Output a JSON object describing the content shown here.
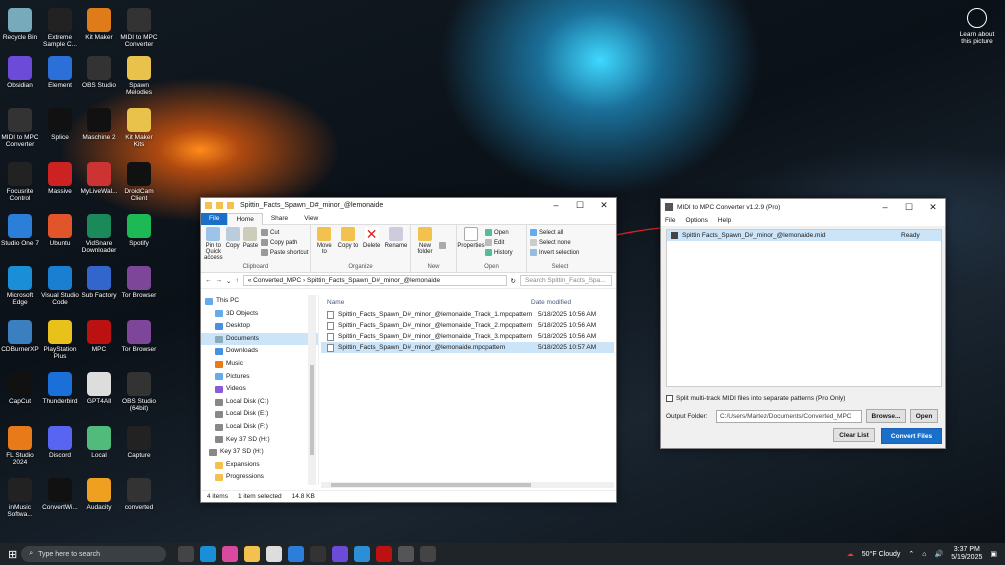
{
  "desktop": {
    "icons": [
      {
        "label": "Recycle Bin",
        "color": "#7ab"
      },
      {
        "label": "Extreme Sample C...",
        "color": "#222"
      },
      {
        "label": "Kit Maker",
        "color": "#e07b1a"
      },
      {
        "label": "MIDI to MPC Converter",
        "color": "#333"
      },
      {
        "label": "Obsidian",
        "color": "#6b4bd8"
      },
      {
        "label": "Element",
        "color": "#2b6fd8"
      },
      {
        "label": "OBS Studio",
        "color": "#333"
      },
      {
        "label": "Spawn Melodies",
        "color": "#e8c24a"
      },
      {
        "label": "MIDI to MPC Converter",
        "color": "#333"
      },
      {
        "label": "Splice",
        "color": "#111"
      },
      {
        "label": "Maschine 2",
        "color": "#111"
      },
      {
        "label": "Kit Maker Kits",
        "color": "#e8c24a"
      },
      {
        "label": "Focusrite Control",
        "color": "#222"
      },
      {
        "label": "Massive",
        "color": "#c22"
      },
      {
        "label": "MyLiveWal...",
        "color": "#c33"
      },
      {
        "label": "DroidCam Client",
        "color": "#111"
      },
      {
        "label": "Studio One 7",
        "color": "#2b7fd8"
      },
      {
        "label": "Ubuntu",
        "color": "#e2542a"
      },
      {
        "label": "VidSnare Downloader",
        "color": "#1b8a5a"
      },
      {
        "label": "Spotify",
        "color": "#1db954"
      },
      {
        "label": "Microsoft Edge",
        "color": "#1a8fd8"
      },
      {
        "label": "Visual Studio Code",
        "color": "#1a7fd0"
      },
      {
        "label": "Sub Factory",
        "color": "#3366cc"
      },
      {
        "label": "Tor Browser",
        "color": "#7d4698"
      },
      {
        "label": "CDBurnerXP",
        "color": "#3a7fc0"
      },
      {
        "label": "PlayStation Plus",
        "color": "#e8c21a"
      },
      {
        "label": "MPC",
        "color": "#b11"
      },
      {
        "label": "Tor Browser",
        "color": "#7d4698"
      },
      {
        "label": "CapCut",
        "color": "#111"
      },
      {
        "label": "Thunderbird",
        "color": "#1a6fd8"
      },
      {
        "label": "GPT4All",
        "color": "#ddd"
      },
      {
        "label": "OBS Studio (64bit)",
        "color": "#333"
      },
      {
        "label": "FL Studio 2024",
        "color": "#e87a1a"
      },
      {
        "label": "Discord",
        "color": "#5865f2"
      },
      {
        "label": "Local",
        "color": "#51bb7b"
      },
      {
        "label": "Capture",
        "color": "#222"
      },
      {
        "label": "inMusic Softwa...",
        "color": "#222"
      },
      {
        "label": "ConvertWi...",
        "color": "#111"
      },
      {
        "label": "Audacity",
        "color": "#f0a020"
      },
      {
        "label": "converted",
        "color": "#333"
      }
    ],
    "learn": "Learn about this picture"
  },
  "explorer": {
    "title": "Spittin_Facts_Spawn_D#_minor_@lemonaide",
    "tabs": [
      "File",
      "Home",
      "Share",
      "View"
    ],
    "ribbon": {
      "clipboard": {
        "label": "Clipboard",
        "pin": "Pin to Quick access",
        "copy": "Copy",
        "paste": "Paste",
        "cut": "Cut",
        "copy_path": "Copy path",
        "paste_shortcut": "Paste shortcut"
      },
      "organize": {
        "label": "Organize",
        "move": "Move to",
        "copy": "Copy to",
        "delete": "Delete",
        "rename": "Rename"
      },
      "new": {
        "label": "New",
        "folder": "New folder"
      },
      "open": {
        "label": "Open",
        "properties": "Properties",
        "open": "Open",
        "edit": "Edit",
        "history": "History"
      },
      "select": {
        "label": "Select",
        "all": "Select all",
        "none": "Select none",
        "invert": "Invert selection"
      }
    },
    "address": {
      "prefix": "«",
      "part1": "Converted_MPC",
      "sep": "›",
      "part2": "Spittin_Facts_Spawn_D#_minor_@lemonaide",
      "search": "Search Spittin_Facts_Spa..."
    },
    "nav": [
      "This PC",
      "3D Objects",
      "Desktop",
      "Documents",
      "Downloads",
      "Music",
      "Pictures",
      "Videos",
      "Local Disk (C:)",
      "Local Disk (E:)",
      "Local Disk (F:)",
      "Key 37 SD (H:)",
      "Key 37 SD (H:)",
      "Expansions",
      "Progressions"
    ],
    "columns": {
      "name": "Name",
      "date": "Date modified"
    },
    "files": [
      {
        "name": "Spittin_Facts_Spawn_D#_minor_@lemonaide_Track_1.mpcpattern",
        "date": "5/18/2025 10:56 AM"
      },
      {
        "name": "Spittin_Facts_Spawn_D#_minor_@lemonaide_Track_2.mpcpattern",
        "date": "5/18/2025 10:56 AM"
      },
      {
        "name": "Spittin_Facts_Spawn_D#_minor_@lemonaide_Track_3.mpcpattern",
        "date": "5/18/2025 10:56 AM"
      },
      {
        "name": "Spittin_Facts_Spawn_D#_minor_@lemonaide.mpcpattern",
        "date": "5/18/2025 10:57 AM"
      }
    ],
    "status": {
      "items": "4 items",
      "selected": "1 item selected",
      "size": "14.8 KB"
    }
  },
  "converter": {
    "title": "MIDI to MPC Converter v1.2.9 (Pro)",
    "menu": [
      "File",
      "Options",
      "Help"
    ],
    "file": {
      "name": "Spittin Facts_Spawn_D#_minor_@lemonaide.mid",
      "status": "Ready"
    },
    "split_label": "Split multi-track MIDI files into separate patterns (Pro Only)",
    "output_label": "Output Folder:",
    "output_path": "C:/Users/Martez/Documents/Converted_MPC",
    "browse": "Browse...",
    "open": "Open",
    "clear": "Clear List",
    "convert": "Convert Files"
  },
  "taskbar": {
    "search": "Type here to search",
    "weather": "50°F  Cloudy",
    "time": "3:37 PM",
    "date": "5/19/2025"
  }
}
